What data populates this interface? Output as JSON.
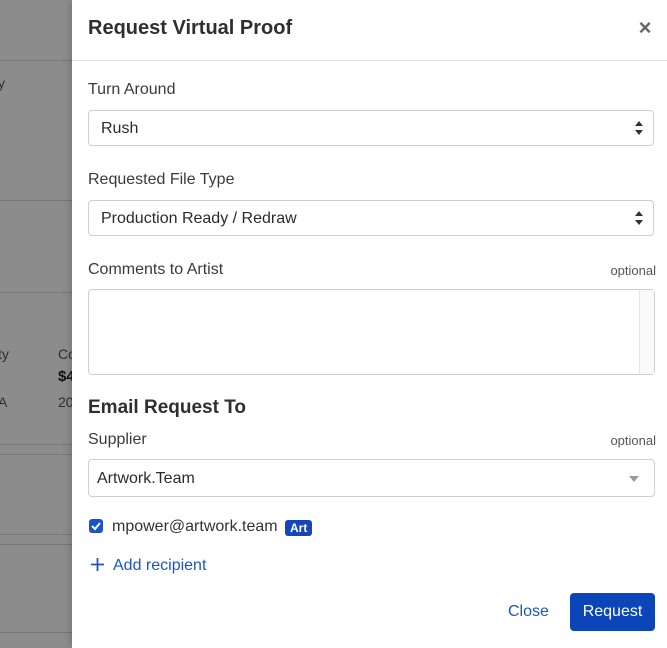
{
  "background": {
    "texts": [
      "y",
      "ty",
      "Co",
      "$4",
      "A",
      "20"
    ]
  },
  "drawer": {
    "title": "Request Virtual Proof",
    "close_glyph": "×"
  },
  "turn_around": {
    "label": "Turn Around",
    "value": "Rush"
  },
  "file_type": {
    "label": "Requested File Type",
    "value": "Production Ready / Redraw"
  },
  "comments": {
    "label": "Comments to Artist",
    "optional": "optional",
    "value": ""
  },
  "email": {
    "section_title": "Email Request To",
    "supplier_label": "Supplier",
    "supplier_optional": "optional",
    "supplier_value": "Artwork.Team",
    "recipient_email": "mpower@artwork.team",
    "recipient_badge": "Art",
    "add_recipient": "Add recipient"
  },
  "actions": {
    "close": "Close",
    "request": "Request"
  },
  "colors": {
    "primary": "#0b45b7",
    "link": "#1a56c9",
    "overlay": "rgba(0,0,0,0.45)"
  }
}
